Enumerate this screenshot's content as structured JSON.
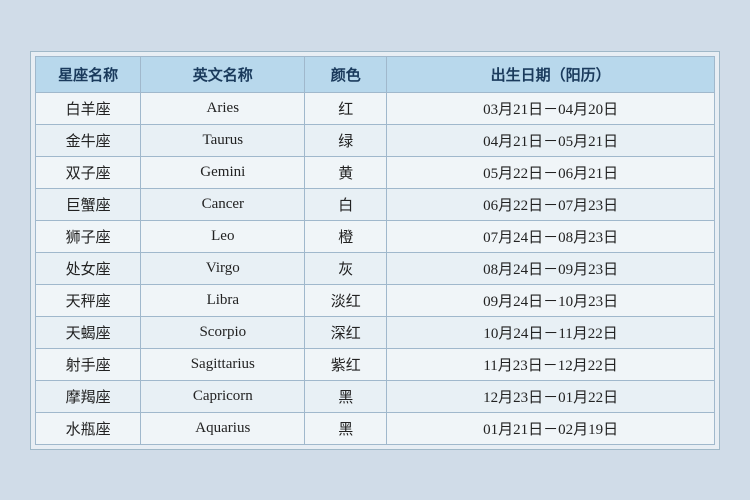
{
  "headers": {
    "col1": "星座名称",
    "col2": "英文名称",
    "col3": "颜色",
    "col4": "出生日期（阳历）"
  },
  "rows": [
    {
      "chinese": "白羊座",
      "english": "Aries",
      "color": "红",
      "date": "03月21日－04月20日"
    },
    {
      "chinese": "金牛座",
      "english": "Taurus",
      "color": "绿",
      "date": "04月21日－05月21日"
    },
    {
      "chinese": "双子座",
      "english": "Gemini",
      "color": "黄",
      "date": "05月22日－06月21日"
    },
    {
      "chinese": "巨蟹座",
      "english": "Cancer",
      "color": "白",
      "date": "06月22日－07月23日"
    },
    {
      "chinese": "狮子座",
      "english": "Leo",
      "color": "橙",
      "date": "07月24日－08月23日"
    },
    {
      "chinese": "处女座",
      "english": "Virgo",
      "color": "灰",
      "date": "08月24日－09月23日"
    },
    {
      "chinese": "天秤座",
      "english": "Libra",
      "color": "淡红",
      "date": "09月24日－10月23日"
    },
    {
      "chinese": "天蝎座",
      "english": "Scorpio",
      "color": "深红",
      "date": "10月24日－11月22日"
    },
    {
      "chinese": "射手座",
      "english": "Sagittarius",
      "color": "紫红",
      "date": "11月23日－12月22日"
    },
    {
      "chinese": "摩羯座",
      "english": "Capricorn",
      "color": "黑",
      "date": "12月23日－01月22日"
    },
    {
      "chinese": "水瓶座",
      "english": "Aquarius",
      "color": "黑",
      "date": "01月21日－02月19日"
    }
  ]
}
